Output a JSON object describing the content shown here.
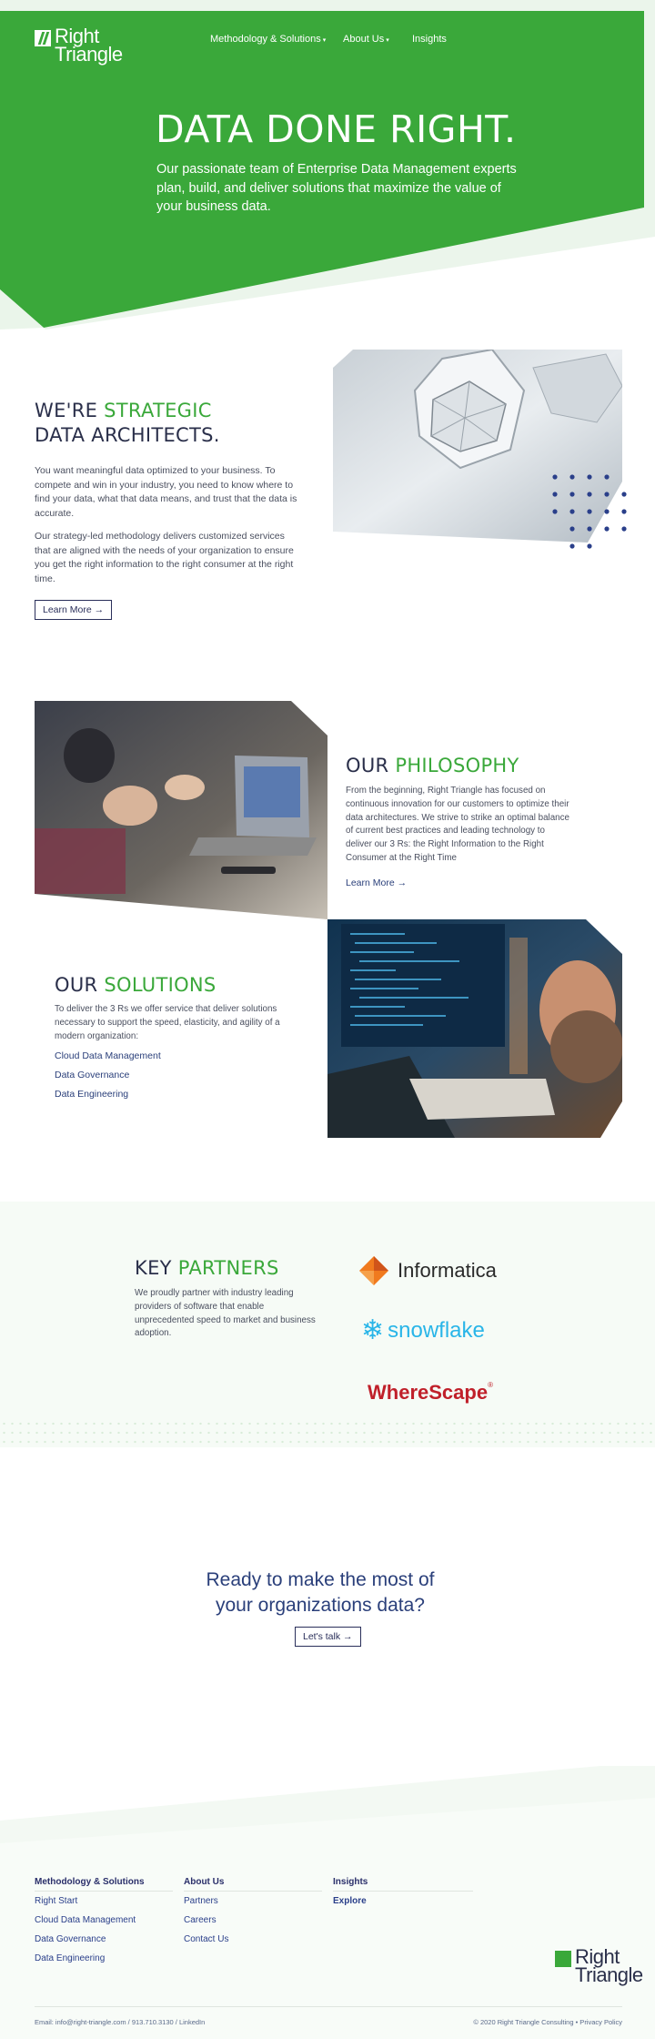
{
  "header": {
    "logo_line1": "Right",
    "logo_line2": "Triangle",
    "nav": [
      {
        "label": "Methodology & Solutions",
        "has_caret": true
      },
      {
        "label": "About Us",
        "has_caret": true
      },
      {
        "label": "Insights",
        "has_caret": false
      }
    ]
  },
  "hero": {
    "title": "DATA DONE RIGHT.",
    "subtitle": "Our passionate team of Enterprise Data Management experts plan, build, and deliver solutions that maximize the value of your business data."
  },
  "architects": {
    "title_a": "WE'RE ",
    "title_b": "STRATEGIC",
    "title_c": "DATA ARCHITECTS.",
    "p1": "You want meaningful data optimized to your business. To compete and win in your industry, you need to know where to find your data, what that data means, and trust that the data is accurate.",
    "p2": "Our strategy-led methodology delivers customized services that are aligned with the needs of your organization to ensure you get the right information to the right consumer at the right time.",
    "button": "Learn More →"
  },
  "philosophy": {
    "title_a": "OUR ",
    "title_b": "PHILOSOPHY",
    "text": "From the beginning, Right Triangle has focused on continuous innovation for our customers to optimize their data architectures. We strive to strike an optimal balance of current best practices and leading technology to deliver our 3 Rs: the Right Information to the Right Consumer at the Right Time",
    "link": "Learn More →"
  },
  "solutions": {
    "title_a": "OUR ",
    "title_b": "SOLUTIONS",
    "text": "To deliver the 3 Rs we offer service that deliver solutions necessary to support the speed, elasticity, and agility of a modern organization:",
    "links": [
      "Cloud Data Management",
      "Data Governance",
      "Data Engineering"
    ]
  },
  "partners": {
    "title_a": "KEY ",
    "title_b": "PARTNERS",
    "text": "We proudly partner with industry leading providers of software that enable unprecedented speed to market and business adoption.",
    "logos": [
      "Informatica",
      "snowflake",
      "WhereScape"
    ]
  },
  "cta": {
    "line1": "Ready to make the most of",
    "line2": "your organizations data?",
    "button": "Let's talk →"
  },
  "footer": {
    "columns": [
      {
        "heading": "Methodology & Solutions",
        "links": [
          "Right Start",
          "Cloud Data Management",
          "Data Governance",
          "Data Engineering"
        ]
      },
      {
        "heading": "About Us",
        "links": [
          "Partners",
          "Careers",
          "Contact Us"
        ]
      },
      {
        "heading": "Insights",
        "links": [
          "Explore"
        ]
      }
    ],
    "contact": "Email: info@right-triangle.com  /  913.710.3130  /  LinkedIn",
    "copyright": "© 2020 Right Triangle Consulting  •  Privacy Policy"
  },
  "colors": {
    "brand_green": "#3aa83a",
    "navy": "#2a2f6a"
  }
}
